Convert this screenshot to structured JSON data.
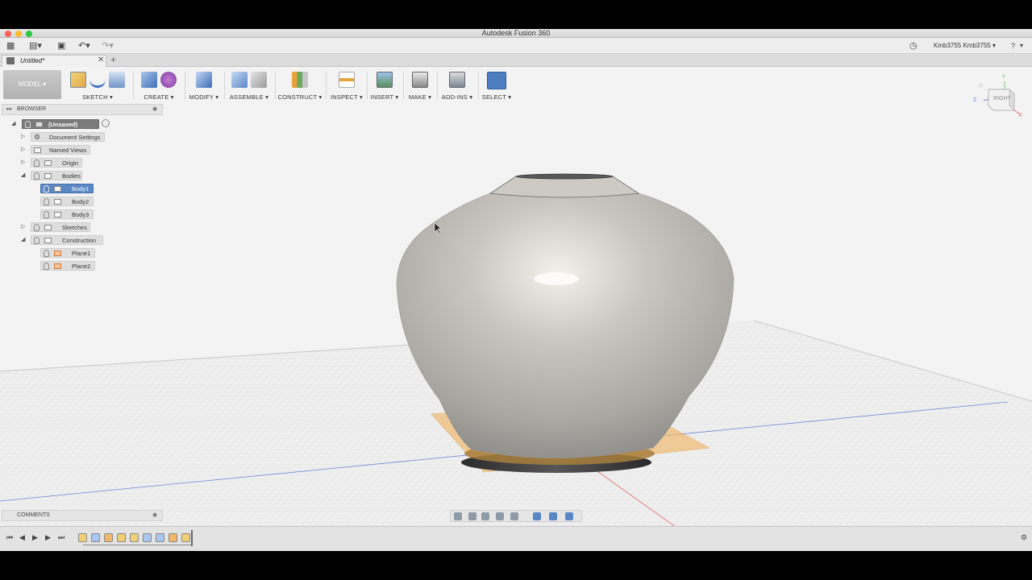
{
  "window": {
    "title": "Autodesk Fusion 360"
  },
  "appbar": {
    "user": "Kmb3755 Kmb3755 ▾",
    "help": "?"
  },
  "tab": {
    "label": "Untitled*",
    "close": "✕",
    "new": "+"
  },
  "ribbon": {
    "workspace": "MODEL ▾",
    "groups": [
      {
        "label": "SKETCH ▾"
      },
      {
        "label": "CREATE ▾"
      },
      {
        "label": "MODIFY ▾"
      },
      {
        "label": "ASSEMBLE ▾"
      },
      {
        "label": "CONSTRUCT ▾"
      },
      {
        "label": "INSPECT ▾"
      },
      {
        "label": "INSERT ▾"
      },
      {
        "label": "MAKE ▾"
      },
      {
        "label": "ADD-INS ▾"
      },
      {
        "label": "SELECT ▾"
      }
    ]
  },
  "browser": {
    "title": "BROWSER",
    "items": [
      {
        "label": "(Unsaved)"
      },
      {
        "label": "Document Settings"
      },
      {
        "label": "Named Views"
      },
      {
        "label": "Origin"
      },
      {
        "label": "Bodies"
      },
      {
        "label": "Body1"
      },
      {
        "label": "Body2"
      },
      {
        "label": "Body3"
      },
      {
        "label": "Sketches"
      },
      {
        "label": "Construction"
      },
      {
        "label": "Plane1"
      },
      {
        "label": "Plane2"
      }
    ]
  },
  "comments": {
    "title": "COMMENTS"
  },
  "viewcube": {
    "face": "RIGHT",
    "axis_z": "Z",
    "axis_x": "X",
    "axis_y": "Y"
  },
  "colors": {
    "accent": "#5a88c4",
    "plane": "#f2b768",
    "vase": "#c4c1bb"
  }
}
